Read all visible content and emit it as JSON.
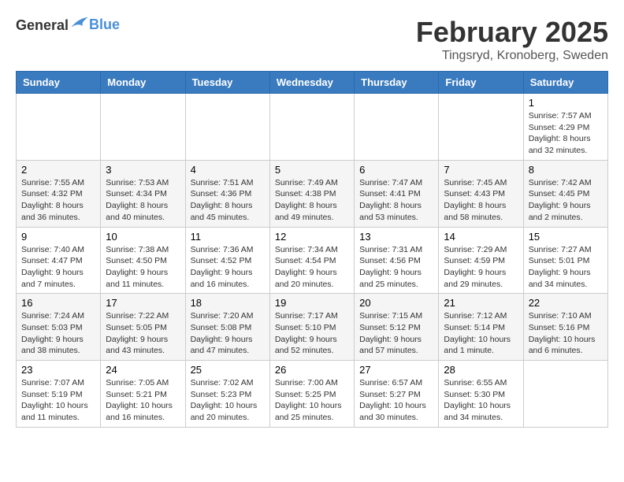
{
  "header": {
    "logo_general": "General",
    "logo_blue": "Blue",
    "title": "February 2025",
    "location": "Tingsryd, Kronoberg, Sweden"
  },
  "days_of_week": [
    "Sunday",
    "Monday",
    "Tuesday",
    "Wednesday",
    "Thursday",
    "Friday",
    "Saturday"
  ],
  "weeks": [
    [
      {
        "day": "",
        "info": ""
      },
      {
        "day": "",
        "info": ""
      },
      {
        "day": "",
        "info": ""
      },
      {
        "day": "",
        "info": ""
      },
      {
        "day": "",
        "info": ""
      },
      {
        "day": "",
        "info": ""
      },
      {
        "day": "1",
        "info": "Sunrise: 7:57 AM\nSunset: 4:29 PM\nDaylight: 8 hours and 32 minutes."
      }
    ],
    [
      {
        "day": "2",
        "info": "Sunrise: 7:55 AM\nSunset: 4:32 PM\nDaylight: 8 hours and 36 minutes."
      },
      {
        "day": "3",
        "info": "Sunrise: 7:53 AM\nSunset: 4:34 PM\nDaylight: 8 hours and 40 minutes."
      },
      {
        "day": "4",
        "info": "Sunrise: 7:51 AM\nSunset: 4:36 PM\nDaylight: 8 hours and 45 minutes."
      },
      {
        "day": "5",
        "info": "Sunrise: 7:49 AM\nSunset: 4:38 PM\nDaylight: 8 hours and 49 minutes."
      },
      {
        "day": "6",
        "info": "Sunrise: 7:47 AM\nSunset: 4:41 PM\nDaylight: 8 hours and 53 minutes."
      },
      {
        "day": "7",
        "info": "Sunrise: 7:45 AM\nSunset: 4:43 PM\nDaylight: 8 hours and 58 minutes."
      },
      {
        "day": "8",
        "info": "Sunrise: 7:42 AM\nSunset: 4:45 PM\nDaylight: 9 hours and 2 minutes."
      }
    ],
    [
      {
        "day": "9",
        "info": "Sunrise: 7:40 AM\nSunset: 4:47 PM\nDaylight: 9 hours and 7 minutes."
      },
      {
        "day": "10",
        "info": "Sunrise: 7:38 AM\nSunset: 4:50 PM\nDaylight: 9 hours and 11 minutes."
      },
      {
        "day": "11",
        "info": "Sunrise: 7:36 AM\nSunset: 4:52 PM\nDaylight: 9 hours and 16 minutes."
      },
      {
        "day": "12",
        "info": "Sunrise: 7:34 AM\nSunset: 4:54 PM\nDaylight: 9 hours and 20 minutes."
      },
      {
        "day": "13",
        "info": "Sunrise: 7:31 AM\nSunset: 4:56 PM\nDaylight: 9 hours and 25 minutes."
      },
      {
        "day": "14",
        "info": "Sunrise: 7:29 AM\nSunset: 4:59 PM\nDaylight: 9 hours and 29 minutes."
      },
      {
        "day": "15",
        "info": "Sunrise: 7:27 AM\nSunset: 5:01 PM\nDaylight: 9 hours and 34 minutes."
      }
    ],
    [
      {
        "day": "16",
        "info": "Sunrise: 7:24 AM\nSunset: 5:03 PM\nDaylight: 9 hours and 38 minutes."
      },
      {
        "day": "17",
        "info": "Sunrise: 7:22 AM\nSunset: 5:05 PM\nDaylight: 9 hours and 43 minutes."
      },
      {
        "day": "18",
        "info": "Sunrise: 7:20 AM\nSunset: 5:08 PM\nDaylight: 9 hours and 47 minutes."
      },
      {
        "day": "19",
        "info": "Sunrise: 7:17 AM\nSunset: 5:10 PM\nDaylight: 9 hours and 52 minutes."
      },
      {
        "day": "20",
        "info": "Sunrise: 7:15 AM\nSunset: 5:12 PM\nDaylight: 9 hours and 57 minutes."
      },
      {
        "day": "21",
        "info": "Sunrise: 7:12 AM\nSunset: 5:14 PM\nDaylight: 10 hours and 1 minute."
      },
      {
        "day": "22",
        "info": "Sunrise: 7:10 AM\nSunset: 5:16 PM\nDaylight: 10 hours and 6 minutes."
      }
    ],
    [
      {
        "day": "23",
        "info": "Sunrise: 7:07 AM\nSunset: 5:19 PM\nDaylight: 10 hours and 11 minutes."
      },
      {
        "day": "24",
        "info": "Sunrise: 7:05 AM\nSunset: 5:21 PM\nDaylight: 10 hours and 16 minutes."
      },
      {
        "day": "25",
        "info": "Sunrise: 7:02 AM\nSunset: 5:23 PM\nDaylight: 10 hours and 20 minutes."
      },
      {
        "day": "26",
        "info": "Sunrise: 7:00 AM\nSunset: 5:25 PM\nDaylight: 10 hours and 25 minutes."
      },
      {
        "day": "27",
        "info": "Sunrise: 6:57 AM\nSunset: 5:27 PM\nDaylight: 10 hours and 30 minutes."
      },
      {
        "day": "28",
        "info": "Sunrise: 6:55 AM\nSunset: 5:30 PM\nDaylight: 10 hours and 34 minutes."
      },
      {
        "day": "",
        "info": ""
      }
    ]
  ]
}
